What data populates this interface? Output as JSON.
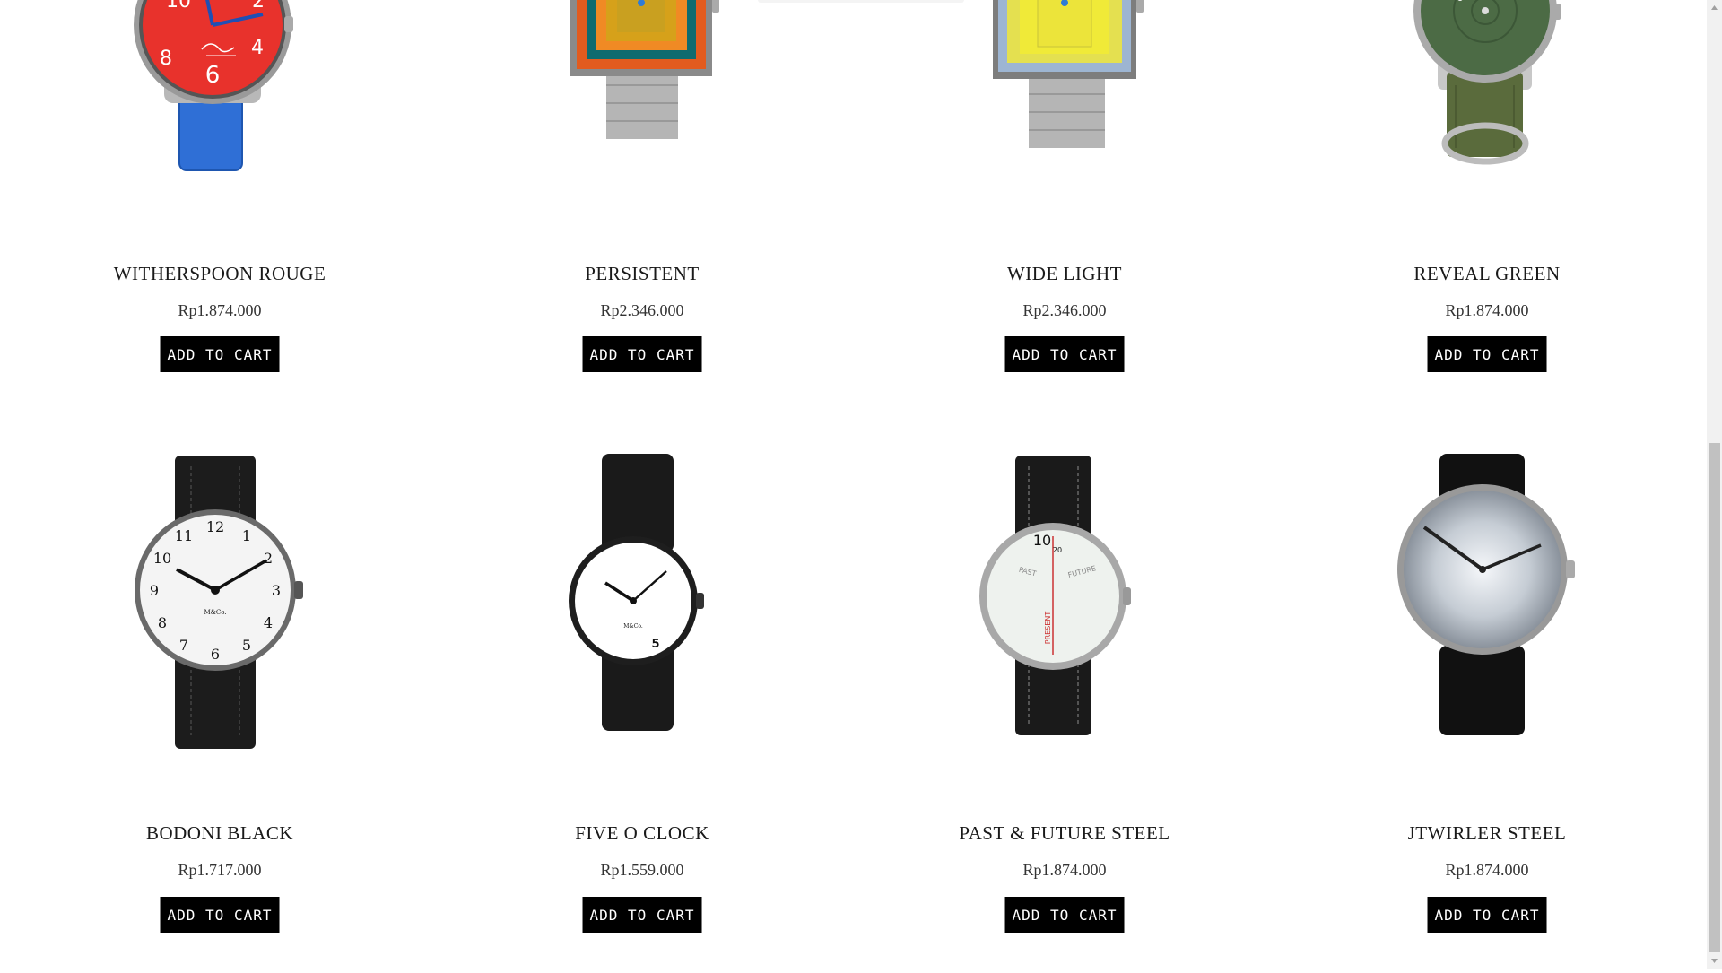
{
  "products": [
    {
      "name": "WITHERSPOON ROUGE",
      "price": "Rp1.874.000",
      "cart_label": "ADD TO CART"
    },
    {
      "name": "PERSISTENT",
      "price": "Rp2.346.000",
      "cart_label": "ADD TO CART"
    },
    {
      "name": "WIDE LIGHT",
      "price": "Rp2.346.000",
      "cart_label": "ADD TO CART"
    },
    {
      "name": "REVEAL GREEN",
      "price": "Rp1.874.000",
      "cart_label": "ADD TO CART"
    },
    {
      "name": "BODONI BLACK",
      "price": "Rp1.717.000",
      "cart_label": "ADD TO CART"
    },
    {
      "name": "FIVE O CLOCK",
      "price": "Rp1.559.000",
      "cart_label": "ADD TO CART"
    },
    {
      "name": "PAST & FUTURE STEEL",
      "price": "Rp1.874.000",
      "cart_label": "ADD TO CART"
    },
    {
      "name": "JTWIRLER STEEL",
      "price": "Rp1.874.000",
      "cart_label": "ADD TO CART"
    }
  ],
  "dial_text": {
    "bodoni_brand": "M&Co.",
    "fiveoclock_brand": "M&Co.",
    "fiveoclock_numeral": "5",
    "pastfuture_past": "PAST",
    "pastfuture_future": "FUTURE",
    "pastfuture_present": "PRESENT",
    "pastfuture_hour": "10",
    "pastfuture_minutes": "20",
    "witherspoon_numerals": [
      "10",
      "2",
      "8",
      "4",
      "6"
    ]
  },
  "colors": {
    "button_bg": "#000000",
    "button_text": "#ffffff",
    "scrollbar_thumb": "#c1c1c1"
  }
}
